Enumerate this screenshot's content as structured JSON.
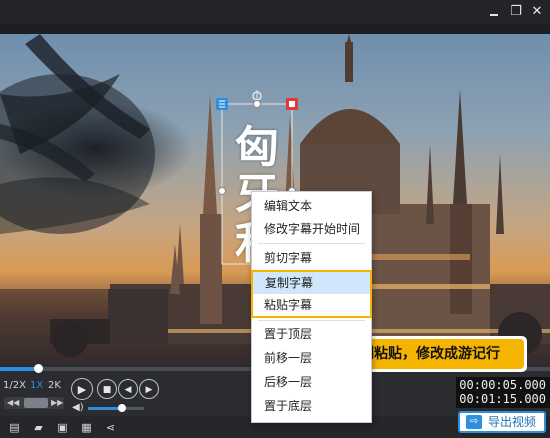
{
  "window": {
    "controls": {
      "restore": "❐",
      "close": "✕"
    }
  },
  "video": {
    "subtitle_chars": [
      "匈",
      "牙",
      "利"
    ]
  },
  "context_menu": {
    "items": [
      {
        "label": "编辑文本"
      },
      {
        "label": "修改字幕开始时间"
      },
      {
        "label": "剪切字幕"
      },
      {
        "label": "复制字幕",
        "highlighted": true
      },
      {
        "label": "粘贴字幕",
        "highlighted": true
      },
      {
        "label": "置于顶层"
      },
      {
        "label": "前移一层"
      },
      {
        "label": "后移一层"
      },
      {
        "label": "置于底层"
      }
    ]
  },
  "tooltip": {
    "text": "复制粘贴，修改成游记行"
  },
  "player": {
    "speeds": [
      "1/2X",
      "1X",
      "2K"
    ],
    "active_speed": "1X",
    "progress": 0.07,
    "volume": 0.6,
    "current_time": "00:00:05.000",
    "total_time": "00:01:15.000"
  },
  "toolbar": {
    "export_label": "导出视频"
  },
  "colors": {
    "accent": "#2f8fdc",
    "tooltip_bg": "#f5b400",
    "highlight_border": "#f5b400",
    "highlight_bg": "#cfe6fb"
  }
}
